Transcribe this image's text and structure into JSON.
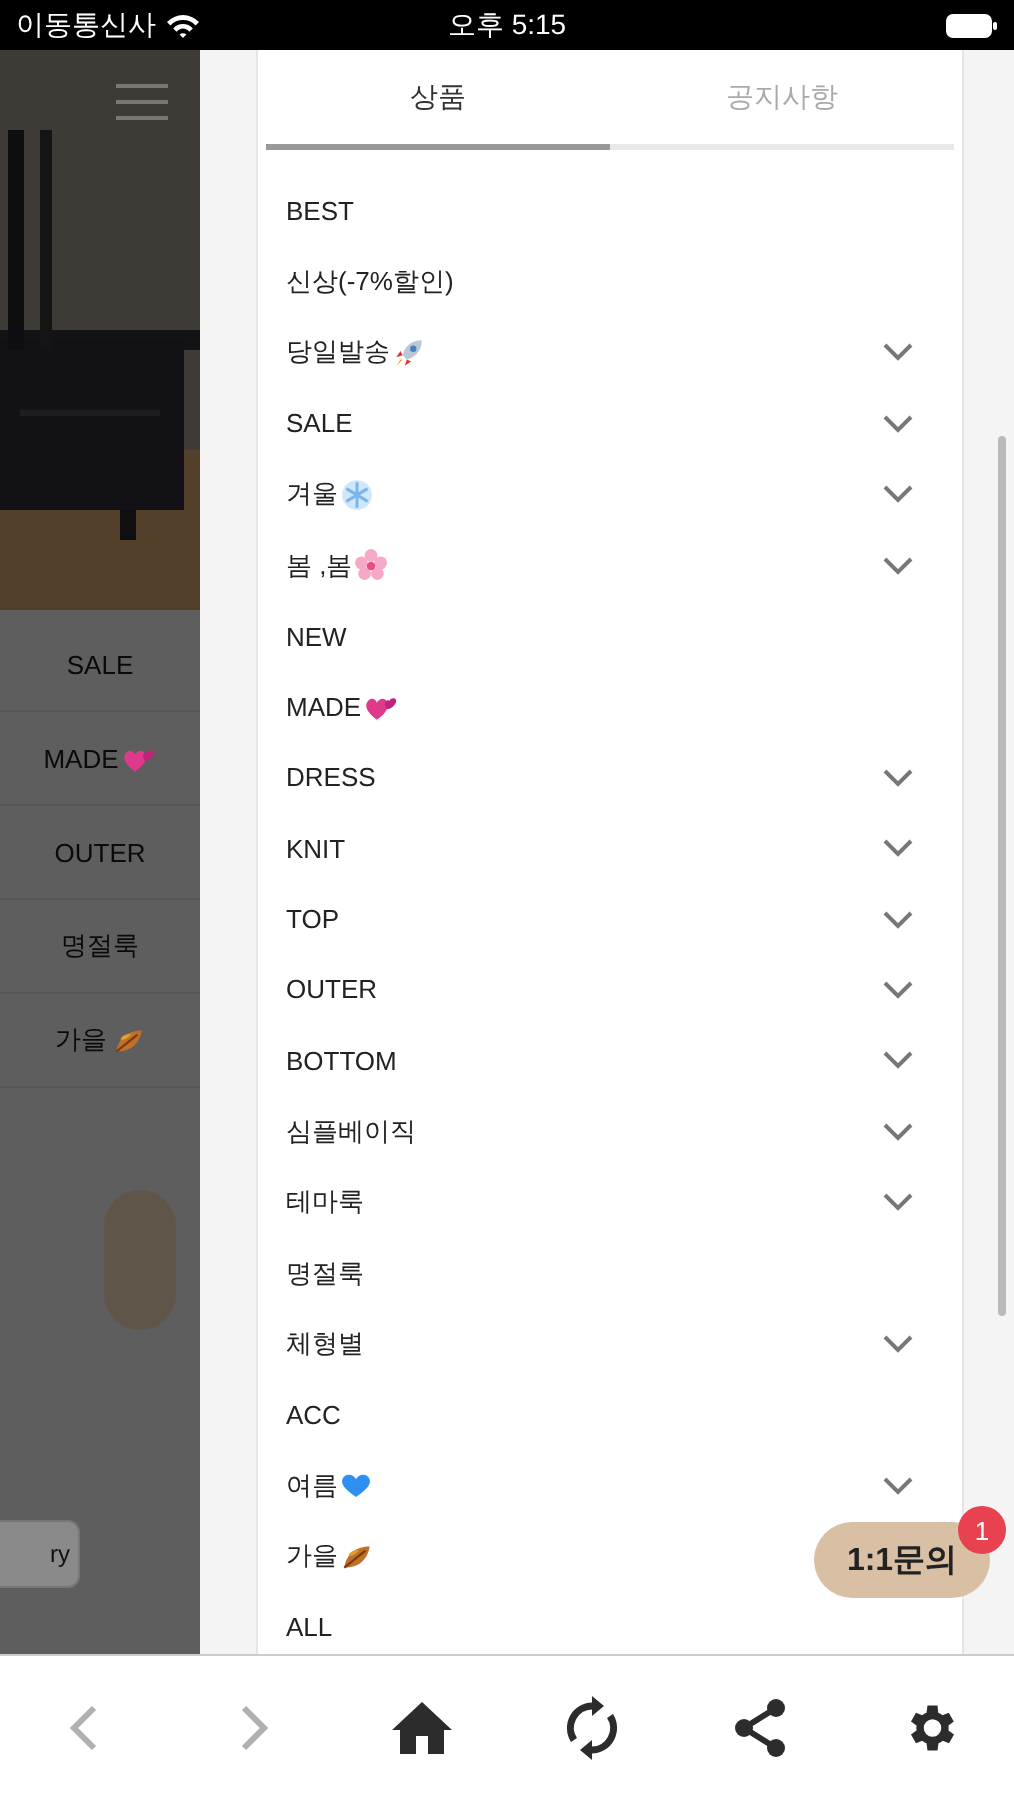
{
  "status_bar": {
    "carrier": "이동통신사",
    "time": "오후 5:15"
  },
  "background_page": {
    "menu": [
      {
        "label": "SALE",
        "kind": "plain"
      },
      {
        "label": "MADE",
        "kind": "hearts"
      },
      {
        "label": "OUTER",
        "kind": "plain"
      },
      {
        "label": "명절룩",
        "kind": "plain"
      },
      {
        "label": "가을",
        "kind": "leaf"
      }
    ],
    "field_text": "ry"
  },
  "tabs": [
    {
      "label": "상품",
      "selected": true
    },
    {
      "label": "공지사항",
      "selected": false
    }
  ],
  "categories": [
    {
      "label": "BEST",
      "kind": "plain",
      "expandable": false
    },
    {
      "label": "신상(-7%할인)",
      "kind": "plain",
      "expandable": false
    },
    {
      "label": "당일발송",
      "kind": "rocket",
      "expandable": true
    },
    {
      "label": "SALE",
      "kind": "plain",
      "expandable": true
    },
    {
      "label": "겨울",
      "kind": "snowflake",
      "expandable": true
    },
    {
      "label": "봄 ,봄",
      "kind": "blossom",
      "expandable": true
    },
    {
      "label": "NEW",
      "kind": "plain",
      "expandable": false
    },
    {
      "label": "MADE",
      "kind": "hearts",
      "expandable": false
    },
    {
      "label": "DRESS",
      "kind": "plain",
      "expandable": true
    },
    {
      "label": "KNIT",
      "kind": "plain",
      "expandable": true
    },
    {
      "label": "TOP",
      "kind": "plain",
      "expandable": true
    },
    {
      "label": "OUTER",
      "kind": "plain",
      "expandable": true
    },
    {
      "label": "BOTTOM",
      "kind": "plain",
      "expandable": true
    },
    {
      "label": "심플베이직",
      "kind": "plain",
      "expandable": true
    },
    {
      "label": "테마룩",
      "kind": "plain",
      "expandable": true
    },
    {
      "label": "명절룩",
      "kind": "plain",
      "expandable": false
    },
    {
      "label": "체형별",
      "kind": "plain",
      "expandable": true
    },
    {
      "label": "ACC",
      "kind": "plain",
      "expandable": false
    },
    {
      "label": "여름",
      "kind": "blueheart",
      "expandable": true
    },
    {
      "label": "가을",
      "kind": "leaf"
    },
    {
      "label": "ALL",
      "kind": "plain",
      "expandable": false
    }
  ],
  "chat_button": {
    "label": "1:1문의",
    "badge": "1"
  },
  "bottom_nav": [
    {
      "kind": "back",
      "disabled": true
    },
    {
      "kind": "forward",
      "disabled": true
    },
    {
      "kind": "home",
      "disabled": false
    },
    {
      "kind": "refresh",
      "disabled": false
    },
    {
      "kind": "share",
      "disabled": false
    },
    {
      "kind": "settings",
      "disabled": false
    }
  ]
}
